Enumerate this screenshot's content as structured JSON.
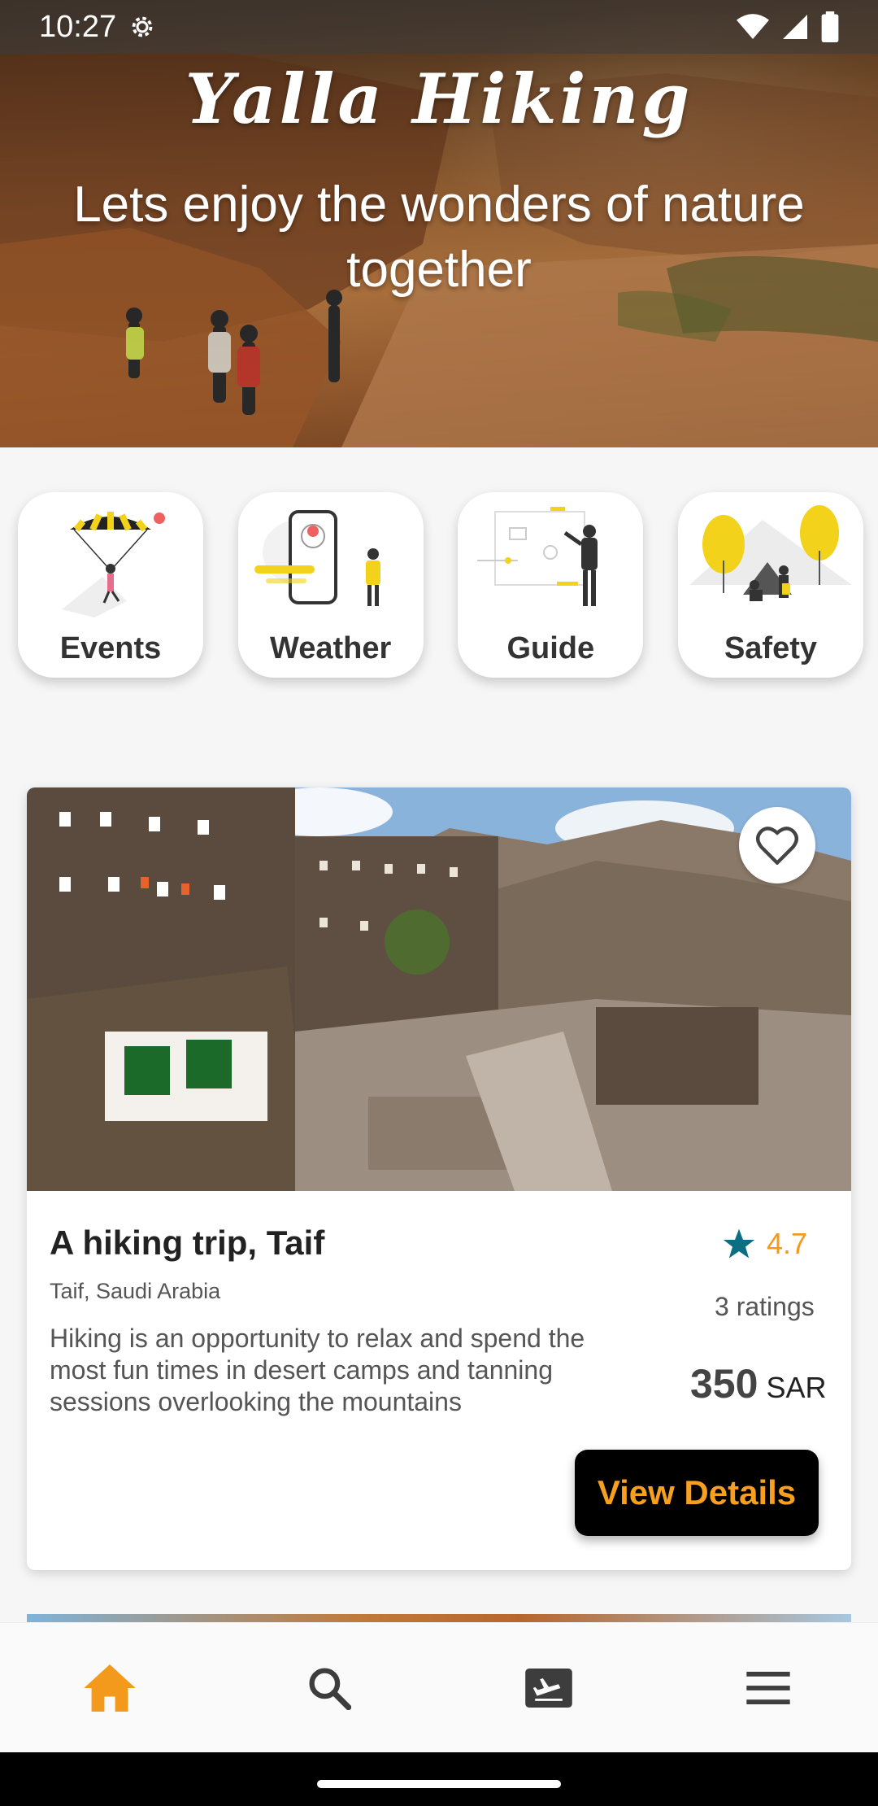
{
  "status_bar": {
    "time": "10:27"
  },
  "hero": {
    "brand": "Yalla Hiking",
    "tagline": "Lets enjoy the wonders of nature together"
  },
  "categories": [
    {
      "label": "Events",
      "icon": "parachute-illustration"
    },
    {
      "label": "Weather",
      "icon": "phone-weather-illustration"
    },
    {
      "label": "Guide",
      "icon": "board-guide-illustration"
    },
    {
      "label": "Safety",
      "icon": "camping-safety-illustration"
    }
  ],
  "trip": {
    "title": "A hiking trip, Taif",
    "location": "Taif, Saudi Arabia",
    "description": "Hiking is an opportunity to relax and spend the most fun times in desert camps and tanning sessions overlooking the mountains",
    "rating": "4.7",
    "ratings_count": "3 ratings",
    "price": "350",
    "currency": "SAR",
    "cta": "View Details"
  },
  "bottom_nav": [
    {
      "icon": "home-icon",
      "active": true
    },
    {
      "icon": "search-icon",
      "active": false
    },
    {
      "icon": "ticket-icon",
      "active": false
    },
    {
      "icon": "menu-icon",
      "active": false
    }
  ],
  "colors": {
    "accent": "#f39a1d",
    "star": "#0b6e83",
    "nav_inactive": "#3d3d3d",
    "button_bg": "#000000"
  }
}
